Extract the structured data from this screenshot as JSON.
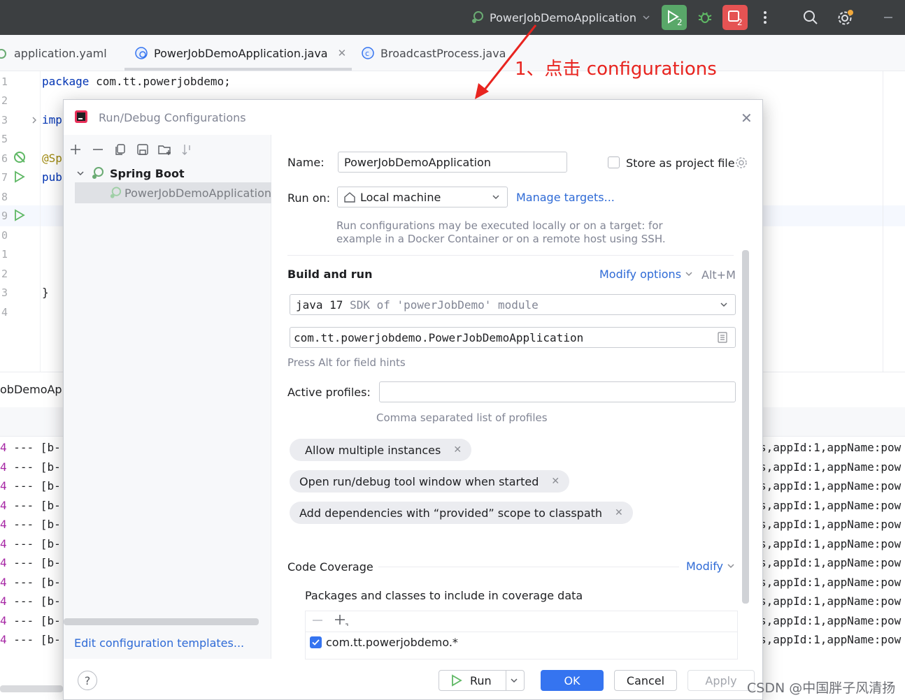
{
  "topbar": {
    "run_config_name": "PowerJobDemoApplication",
    "run_badge": "2",
    "stop_badge": "2"
  },
  "tabs": [
    {
      "label": "application.yaml"
    },
    {
      "label": "PowerJobDemoApplication.java"
    },
    {
      "label": "BroadcastProcess.java"
    }
  ],
  "editor": {
    "line_numbers": [
      "1",
      "2",
      "3",
      "5",
      "6",
      "7",
      "8",
      "9",
      "0",
      "1",
      "2",
      "3",
      "4"
    ],
    "lines": {
      "l1_kw": "package",
      "l1_rest": " com.tt.powerjobdemo;",
      "l3": "imp",
      "l6": "@Sp",
      "l7": "pub",
      "l13": "}"
    }
  },
  "run_window": {
    "title": "obDemoApp",
    "log_left_num": "4",
    "log_left_rest": " --- [b-",
    "log_right": "s,appId:1,appName:pow",
    "log_count": 11
  },
  "annotation": {
    "text": "1、点击 configurations",
    "color": "#e8241f"
  },
  "dialog": {
    "title": "Run/Debug Configurations",
    "tree": {
      "group": "Spring Boot",
      "item": "PowerJobDemoApplication"
    },
    "edit_templates_link": "Edit configuration templates...",
    "name_label": "Name:",
    "name_value": "PowerJobDemoApplication",
    "store_as_project_file": "Store as project file",
    "run_on_label": "Run on:",
    "run_on_value": "Local machine",
    "manage_targets": "Manage targets...",
    "run_on_hint_1": "Run configurations may be executed locally or on a target: for",
    "run_on_hint_2": "example in a Docker Container or on a remote host using SSH.",
    "build_and_run": "Build and run",
    "modify_options": "Modify options",
    "modify_shortcut": "Alt+M",
    "sdk_kw": "java 17",
    "sdk_rest": " SDK of 'powerJobDemo' module",
    "main_class": "com.tt.powerjobdemo.PowerJobDemoApplication",
    "field_hints": "Press Alt for field hints",
    "active_profiles_label": "Active profiles:",
    "active_profiles_value": "",
    "active_profiles_hint": "Comma separated list of profiles",
    "chips": [
      "Allow multiple instances",
      "Open run/debug tool window when started",
      "Add dependencies with “provided” scope to classpath"
    ],
    "code_coverage": "Code Coverage",
    "modify": "Modify",
    "coverage_packages_label": "Packages and classes to include in coverage data",
    "coverage_entry": "com.tt.powerjobdemo.*",
    "buttons": {
      "help": "?",
      "run": "Run",
      "ok": "OK",
      "cancel": "Cancel",
      "apply": "Apply"
    }
  },
  "watermark": "CSDN @中国胖子风清扬",
  "colors": {
    "accent": "#3574f0",
    "run_green": "#59a869",
    "stop_red": "#e55353",
    "link": "#2e6ad6"
  }
}
